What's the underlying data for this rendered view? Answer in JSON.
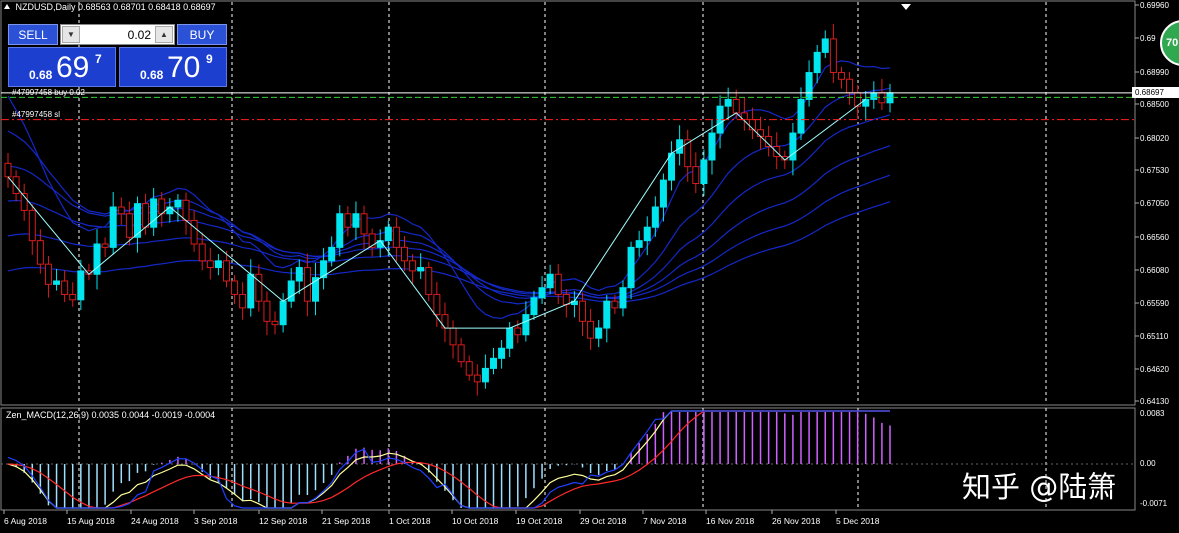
{
  "header": {
    "symbol_timeframe": "NZDUSD,Daily",
    "ohlc": "0.68563 0.68701 0.68418 0.68697"
  },
  "trade_panel": {
    "sell_label": "SELL",
    "buy_label": "BUY",
    "lot_value": "0.02",
    "bid": {
      "prefix": "0.68",
      "big": "69",
      "sup": "7"
    },
    "ask": {
      "prefix": "0.68",
      "big": "70",
      "sup": "9"
    }
  },
  "orders": {
    "buy_label": "#47997458 buy 0.02",
    "sl_label": "#47997458 sl"
  },
  "price_axis": {
    "ticks": [
      "0.69960",
      "0.69",
      "0.68990",
      "0.68500",
      "0.68020",
      "0.67530",
      "0.67050",
      "0.66560",
      "0.66080",
      "0.65590",
      "0.65110",
      "0.64620",
      "0.64130"
    ],
    "current_price": "0.68697"
  },
  "indicator": {
    "label": "Zen_MACD(12,26,9) 0.0035 0.0044 -0.0019 -0.0004",
    "axis_ticks": [
      "0.0083",
      "0.00",
      "-0.0071"
    ]
  },
  "time_axis": {
    "labels": [
      "6 Aug 2018",
      "15 Aug 2018",
      "24 Aug 2018",
      "3 Sep 2018",
      "12 Sep 2018",
      "21 Sep 2018",
      "1 Oct 2018",
      "10 Oct 2018",
      "19 Oct 2018",
      "29 Oct 2018",
      "7 Nov 2018",
      "16 Nov 2018",
      "26 Nov 2018",
      "5 Dec 2018"
    ]
  },
  "colors": {
    "bull_candle": "#00e5ee",
    "bear_candle": "#d81c1c",
    "grid": "#ffffff",
    "ma_ribbon": "#1428c8",
    "zigzag": "#a0ffff",
    "buy_line": "#32cd32",
    "sl_line": "#ff2020"
  },
  "watermark": "知乎 @陆箫",
  "corner_badge": "70",
  "chart_data": {
    "type": "candlestick",
    "symbol": "NZDUSD",
    "timeframe": "Daily",
    "price_range": [
      0.6413,
      0.6996
    ],
    "buy_level": 0.6863,
    "sl_level": 0.683,
    "current_price": 0.68697,
    "close_trend": [
      [
        0.6745,
        0.672,
        0.6695,
        0.665,
        0.6615,
        0.6585,
        0.659,
        0.657,
        0.6562,
        0.6605,
        0.66,
        0.6645,
        0.664,
        0.67,
        0.669,
        0.6655,
        0.6705,
        0.667,
        0.6712,
        0.669,
        0.67,
        0.671,
        0.668,
        0.6645
      ],
      [
        0.662,
        0.661,
        0.662,
        0.659,
        0.657,
        0.655,
        0.66,
        0.656,
        0.653,
        0.6525,
        0.656,
        0.659,
        0.661,
        0.656,
        0.6595,
        0.662,
        0.664,
        0.669,
        0.667,
        0.669,
        0.666,
        0.664,
        0.665,
        0.667
      ],
      [
        0.664,
        0.662,
        0.6605,
        0.661,
        0.657,
        0.654,
        0.652,
        0.6495,
        0.647,
        0.645,
        0.644,
        0.646,
        0.6475,
        0.649,
        0.652,
        0.651,
        0.654,
        0.6565,
        0.658,
        0.66,
        0.657,
        0.6555,
        0.656,
        0.653
      ],
      [
        0.6505,
        0.652,
        0.656,
        0.655,
        0.658,
        0.664,
        0.665,
        0.667,
        0.67,
        0.674,
        0.678,
        0.68,
        0.676,
        0.6735,
        0.677,
        0.681,
        0.685,
        0.686,
        0.684,
        0.683,
        0.6815,
        0.6805,
        0.679,
        0.6775
      ],
      [
        0.677,
        0.681,
        0.686,
        0.69,
        0.693,
        0.695,
        0.69,
        0.689,
        0.687,
        0.685,
        0.686,
        0.687,
        0.6855,
        0.687
      ]
    ]
  }
}
